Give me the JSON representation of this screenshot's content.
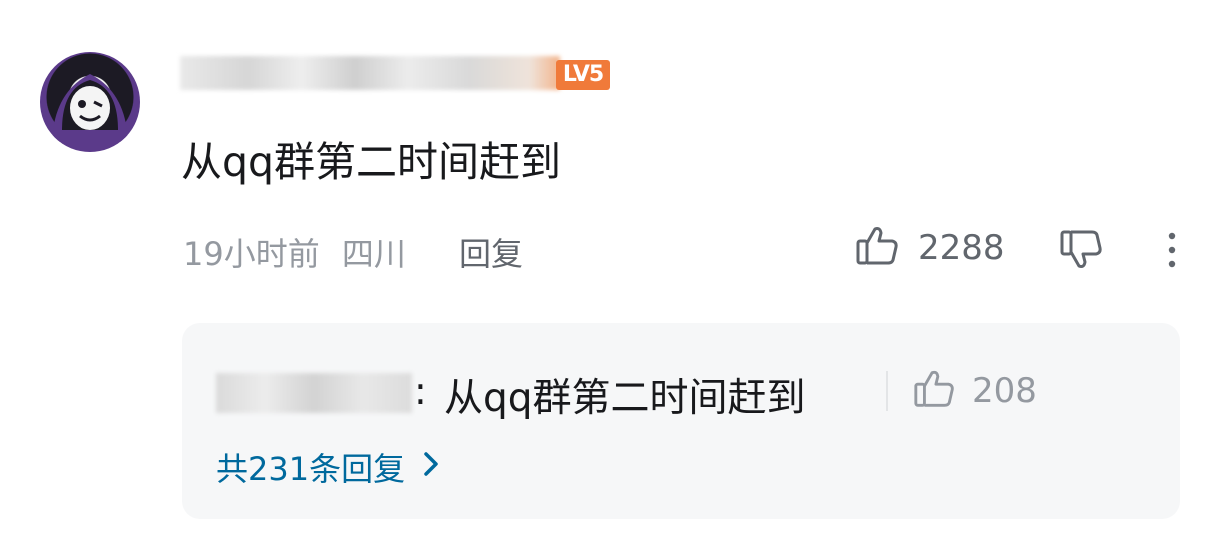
{
  "comment": {
    "level_badge": "LV5",
    "text": "从qq群第二时间赶到",
    "time": "19小时前",
    "location": "四川",
    "reply_label": "回复",
    "like_count": "2288"
  },
  "reply_preview": {
    "colon": ":",
    "text": "从qq群第二时间赶到",
    "like_count": "208",
    "total_replies": "共231条回复"
  },
  "icons": [
    "avatar",
    "thumbs-up-icon",
    "thumbs-down-icon",
    "more-icon",
    "chevron-right-icon"
  ],
  "colors": {
    "link": "#00699d",
    "badge": "#f07a3a",
    "muted": "#9499a0"
  }
}
